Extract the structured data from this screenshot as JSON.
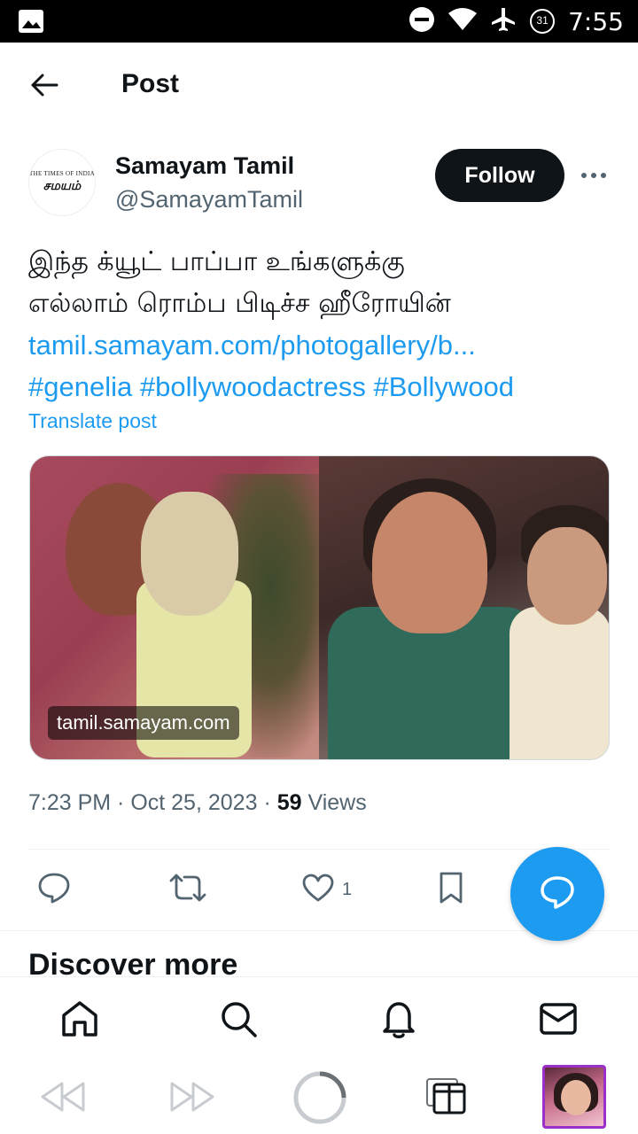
{
  "status_bar": {
    "time": "7:55",
    "battery_level": "31",
    "icons": [
      "image-notification-icon",
      "do-not-disturb-icon",
      "wifi-icon",
      "airplane-mode-icon",
      "battery-icon"
    ]
  },
  "header": {
    "title": "Post",
    "back_icon": "arrow-left-icon"
  },
  "post": {
    "author": {
      "avatar_text_top": "THE TIMES OF INDIA",
      "avatar_text_main": "சமயம்",
      "name": "Samayam Tamil",
      "handle": "@SamayamTamil"
    },
    "follow_label": "Follow",
    "more_icon": "more-horizontal-icon",
    "text_line1": "இந்த க்யூட் பாப்பா உங்களுக்கு",
    "text_line2": "எல்லாம் ரொம்ப பிடிச்ச ஹீரோயின்",
    "link": "tamil.samayam.com/photogallery/b...",
    "hashtags": [
      "#genelia",
      "#bollywoodactress",
      "#Bollywood"
    ],
    "translate_label": "Translate post",
    "media_source_label": "tamil.samayam.com",
    "timestamp": "7:23 PM · Oct 25, 2023",
    "separator": "·",
    "views_count": "59",
    "views_label": "Views",
    "actions": {
      "reply_icon": "reply-icon",
      "repost_icon": "repost-icon",
      "like_icon": "heart-icon",
      "like_count": "1",
      "bookmark_icon": "bookmark-icon"
    }
  },
  "fab_icon": "compose-reply-icon",
  "discover_heading": "Discover more",
  "bottom_nav": [
    "home-icon",
    "search-icon",
    "notifications-icon",
    "messages-icon"
  ],
  "system_bar": [
    "rewind-icon",
    "fast-forward-icon",
    "home-circle-icon",
    "recent-apps-icon",
    "app-thumbnail"
  ],
  "colors": {
    "accent": "#1d9bf0",
    "text": "#0f1419",
    "secondary_text": "#536471",
    "follow_bg": "#0f1419"
  }
}
